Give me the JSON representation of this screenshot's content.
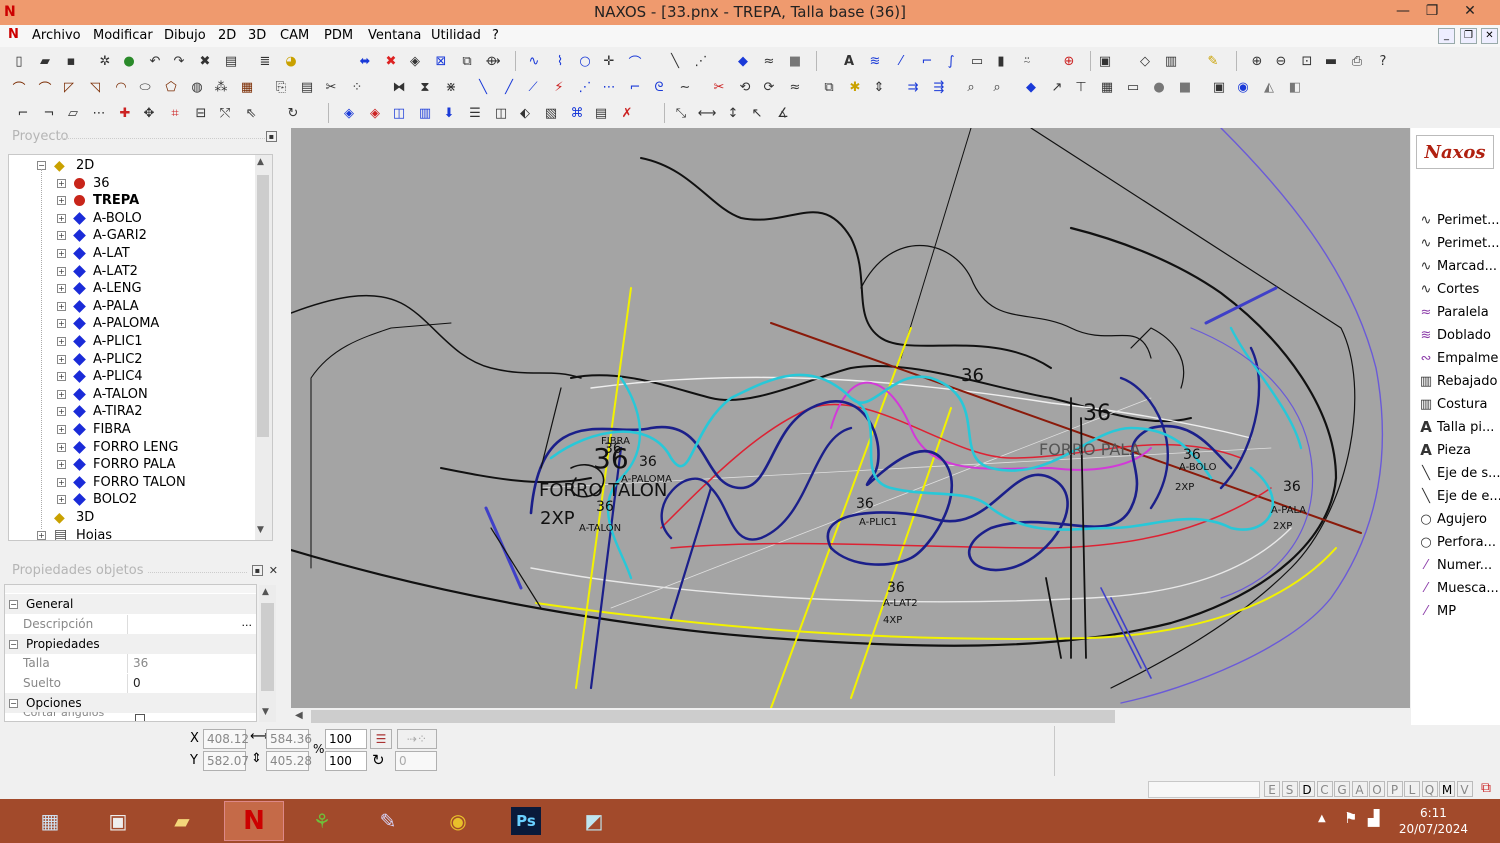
{
  "window": {
    "title": "NAXOS - [33.pnx - TREPA, Talla base (36)]",
    "minimize": "—",
    "maximize": "❐",
    "close": "✕"
  },
  "menu": [
    "Archivo",
    "Modificar",
    "Dibujo",
    "2D",
    "3D",
    "CAM",
    "PDM",
    "Ventana",
    "Utilidad",
    "?"
  ],
  "project_panel": {
    "title": "Proyecto",
    "tree": [
      {
        "label": "2D",
        "icon": "layers-icon"
      },
      {
        "label": "36",
        "icon": "red-dot-icon"
      },
      {
        "label": "TREPA",
        "icon": "red-dot-icon",
        "bold": true
      },
      {
        "label": "A-BOLO",
        "icon": "blue-diamond-icon"
      },
      {
        "label": "A-GARI2",
        "icon": "blue-diamond-icon"
      },
      {
        "label": "A-LAT",
        "icon": "blue-diamond-icon"
      },
      {
        "label": "A-LAT2",
        "icon": "blue-diamond-icon"
      },
      {
        "label": "A-LENG",
        "icon": "blue-diamond-icon"
      },
      {
        "label": "A-PALA",
        "icon": "blue-diamond-icon"
      },
      {
        "label": "A-PALOMA",
        "icon": "blue-diamond-icon"
      },
      {
        "label": "A-PLIC1",
        "icon": "blue-diamond-icon"
      },
      {
        "label": "A-PLIC2",
        "icon": "blue-diamond-icon"
      },
      {
        "label": "A-PLIC4",
        "icon": "blue-diamond-icon"
      },
      {
        "label": "A-TALON",
        "icon": "blue-diamond-icon"
      },
      {
        "label": "A-TIRA2",
        "icon": "blue-diamond-icon"
      },
      {
        "label": "FIBRA",
        "icon": "blue-diamond-icon"
      },
      {
        "label": "FORRO LENG",
        "icon": "blue-diamond-icon"
      },
      {
        "label": "FORRO PALA",
        "icon": "blue-diamond-icon"
      },
      {
        "label": "FORRO TALON",
        "icon": "blue-diamond-icon"
      },
      {
        "label": "BOLO2",
        "icon": "blue-diamond-icon"
      },
      {
        "label": "3D",
        "icon": "layers-icon"
      },
      {
        "label": "Hojas",
        "icon": "sheets-icon"
      }
    ]
  },
  "properties_panel": {
    "title": "Propiedades objetos",
    "sections": {
      "general": "General",
      "propiedades": "Propiedades",
      "opciones": "Opciones"
    },
    "rows": {
      "descripcion_label": "Descripción",
      "descripcion_btn": "...",
      "talla_label": "Talla",
      "talla_value": "36",
      "suelto_label": "Suelto",
      "suelto_value": "0",
      "cortar_label": "Cortar ángulos vivos"
    }
  },
  "canvas_labels": {
    "l36a": "36",
    "l36b": "36",
    "l36c": "36",
    "l36d": "36",
    "l36e": "36",
    "l36f": "36",
    "l36g": "36",
    "l36h": "36",
    "l36i": "36",
    "l36j": "36",
    "forro_talon": "FORRO TALON",
    "forro_pala": "FORRO PALA",
    "xp2a": "2XP",
    "xp2b": "2XP",
    "xp2c": "2XP",
    "xp4": "4XP",
    "atalon": "A-TALON",
    "alat2": "A-LAT2",
    "apaloma": "A-PALOMA",
    "abolo": "A-BOLO",
    "aplic1": "A-PLIC1",
    "apala": "A-PALA",
    "fibra": "FIBRA"
  },
  "right_panel": {
    "logo": "Naxos",
    "items": [
      {
        "label": "Perimet...",
        "icon": "curve-icon"
      },
      {
        "label": "Perimet...",
        "icon": "curve-icon"
      },
      {
        "label": "Marcad...",
        "icon": "curve-icon"
      },
      {
        "label": "Cortes",
        "icon": "curve-icon"
      },
      {
        "label": "Paralela",
        "icon": "parallel-icon"
      },
      {
        "label": "Doblado",
        "icon": "fold-icon"
      },
      {
        "label": "Empalme",
        "icon": "join-icon"
      },
      {
        "label": "Rebajado",
        "icon": "skive-icon"
      },
      {
        "label": "Costura",
        "icon": "seam-icon"
      },
      {
        "label": "Talla pi...",
        "icon": "text-a-icon"
      },
      {
        "label": "Pieza",
        "icon": "text-a-icon"
      },
      {
        "label": "Eje de s...",
        "icon": "axis-icon"
      },
      {
        "label": "Eje de e...",
        "icon": "axis-icon"
      },
      {
        "label": "Agujero",
        "icon": "circle-icon"
      },
      {
        "label": "Perfora...",
        "icon": "circle-icon"
      },
      {
        "label": "Numer...",
        "icon": "number-icon"
      },
      {
        "label": "Muesca...",
        "icon": "notch-icon"
      },
      {
        "label": "MP",
        "icon": "mp-icon"
      }
    ]
  },
  "coords": {
    "x_label": "X",
    "y_label": "Y",
    "x": "408.12",
    "y": "582.07",
    "w": "584.36",
    "h": "405.28",
    "pct_label": "%",
    "scale_x": "100",
    "scale_y": "100",
    "rotation": "0"
  },
  "status_letters": [
    "E",
    "S",
    "D",
    "C",
    "G",
    "A",
    "O",
    "P",
    "L",
    "Q",
    "M",
    "V"
  ],
  "taskbar": {
    "apps": [
      "calculator",
      "explorer",
      "folder",
      "naxos",
      "leaf-app",
      "pen-app",
      "chrome",
      "photoshop",
      "note-app"
    ],
    "ps_label": "Ps",
    "time": "6:11",
    "date": "20/07/2024"
  },
  "colors": {
    "titlebar": "#ef9a6e",
    "canvas": "#a4a4a4",
    "taskbar": "#a24a2b"
  }
}
